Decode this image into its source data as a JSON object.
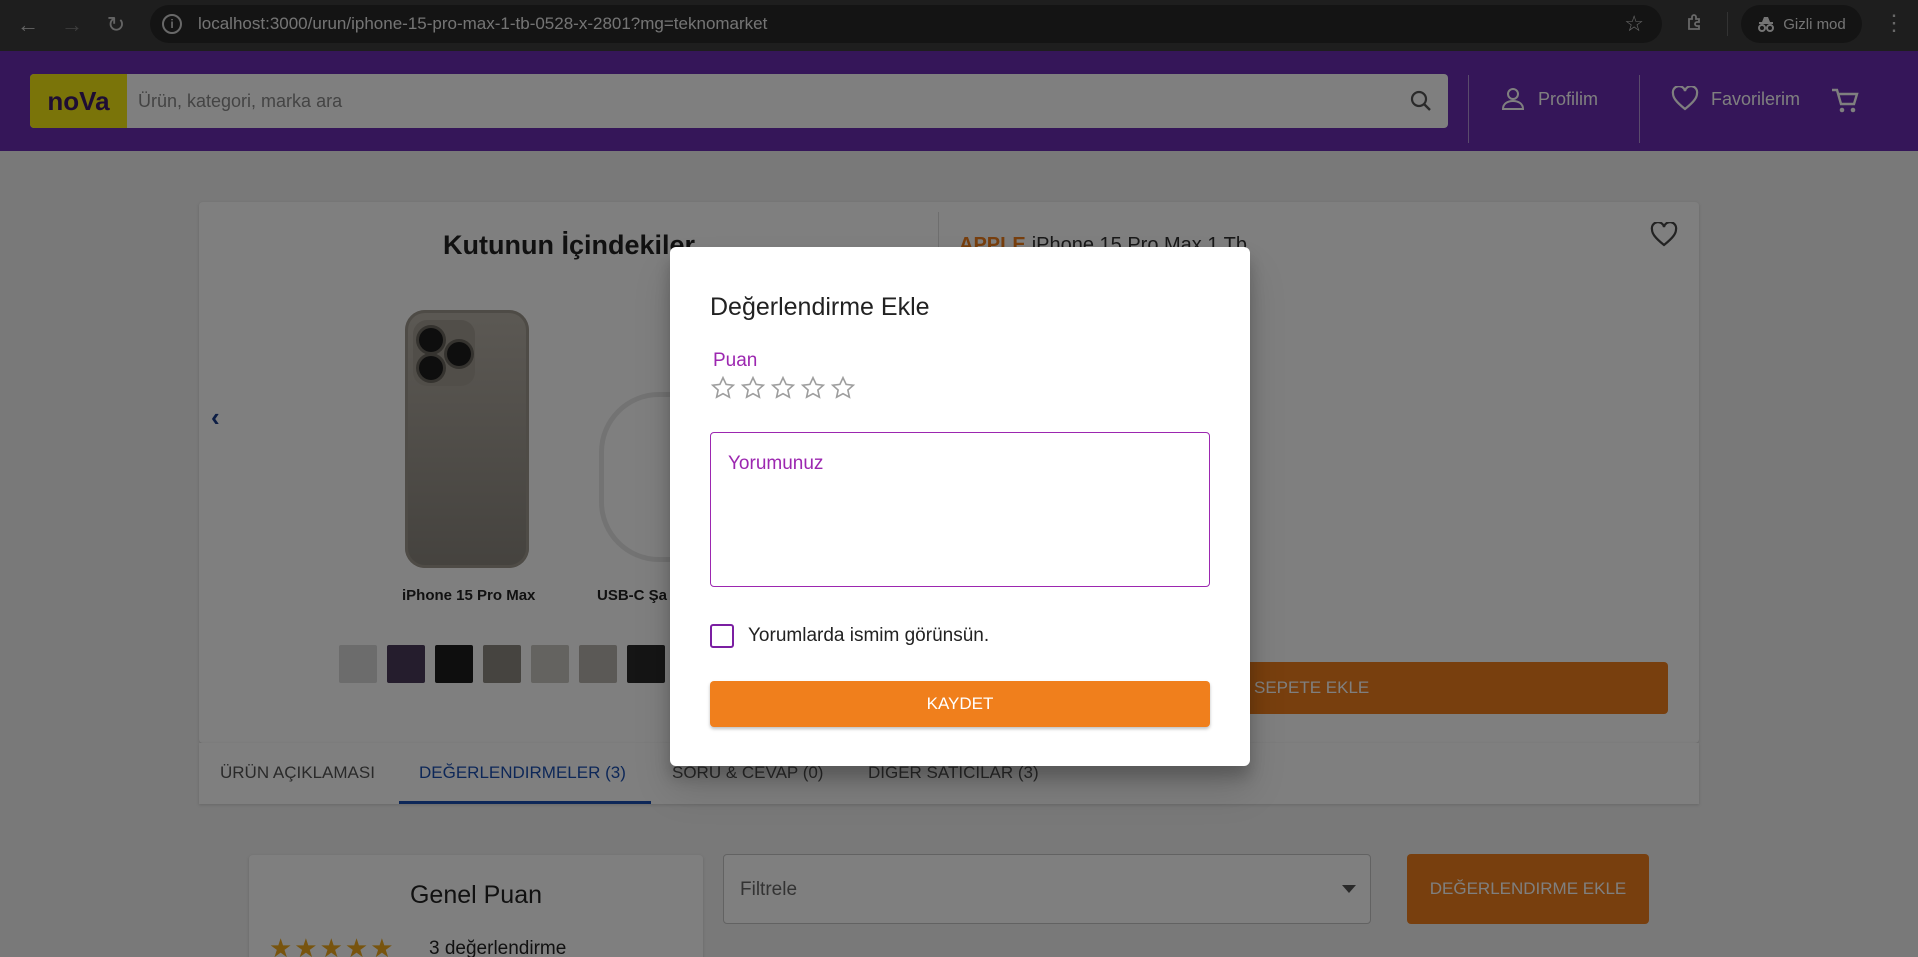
{
  "browser": {
    "url": "localhost:3000/urun/iphone-15-pro-max-1-tb-0528-x-2801?mg=teknomarket",
    "incognito_label": "Gizli mod"
  },
  "header": {
    "logo": "noVa",
    "search_placeholder": "Ürün, kategori, marka ara",
    "profile_label": "Profilim",
    "favorites_label": "Favorilerim"
  },
  "gallery": {
    "title": "Kutunun İçindekiler",
    "items": [
      {
        "label": "iPhone 15 Pro Max"
      },
      {
        "label": "USB-C Şa"
      }
    ],
    "thumb_colors": [
      "#d8d8d8",
      "#4a3b5a",
      "#1c1c1c",
      "#8c8880",
      "#c9c6c0",
      "#b7b3ad",
      "#2a2a2a"
    ]
  },
  "product": {
    "brand": "APPLE",
    "name": "iPhone 15 Pro Max 1 Tb",
    "faded_text": ")",
    "add_to_cart_label": "SEPETE EKLE"
  },
  "tabs": [
    {
      "label": "ÜRÜN AÇIKLAMASI",
      "active": false
    },
    {
      "label": "DEĞERLENDIRMELER (3)",
      "active": true
    },
    {
      "label": "SORU & CEVAP (0)",
      "active": false
    },
    {
      "label": "DIGER SATICILAR (3)",
      "active": false
    }
  ],
  "reviews": {
    "score_title": "Genel Puan",
    "stars": "★★★★★",
    "review_count": "3 değerlendirme",
    "filter_placeholder": "Filtrele",
    "add_review_label": "DEĞERLENDIRME EKLE"
  },
  "modal": {
    "title": "Değerlendirme Ekle",
    "rating_label": "Puan",
    "rating_value": 0,
    "rating_max": 5,
    "comment_placeholder": "Yorumunuz",
    "show_name_label": "Yorumlarda ismim görünsün.",
    "save_label": "KAYDET"
  },
  "colors": {
    "header_purple": "#6a2cb3",
    "logo_yellow": "#f5e812",
    "accent_orange": "#f07f1c",
    "modal_purple": "#9c27b0",
    "tab_blue": "#1a4fb0"
  }
}
